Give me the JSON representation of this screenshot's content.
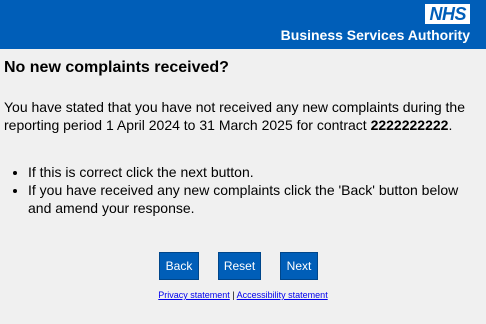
{
  "header": {
    "logo_text": "NHS",
    "org_name": "Business Services Authority",
    "bg_color": "#005eb8"
  },
  "main": {
    "title": "No new complaints received?",
    "statement_text": "You have stated that you have not received any new complaints during the reporting period 1 April 2024 to 31 March 2025 for contract ",
    "contract_number": "2222222222",
    "statement_end": ".",
    "instructions": [
      "If this is correct click the next button.",
      "If you have received any new complaints click the 'Back' button below and amend your response."
    ]
  },
  "buttons": {
    "back_label": "Back",
    "reset_label": "Reset",
    "next_label": "Next"
  },
  "footer": {
    "privacy_label": "Privacy statement",
    "separator": " | ",
    "accessibility_label": "Accessibility statement"
  }
}
